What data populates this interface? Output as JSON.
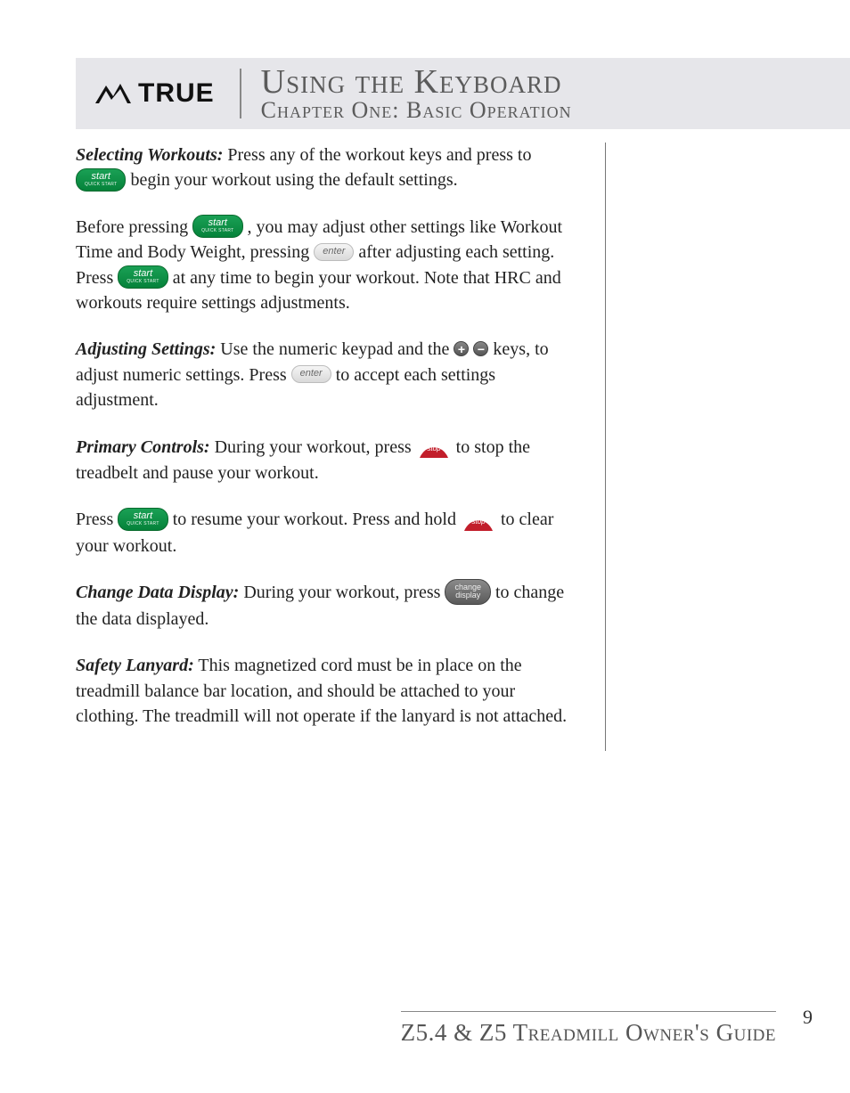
{
  "header": {
    "logo_text": "TRUE",
    "title": "Using the Keyboard",
    "subtitle": "Chapter One: Basic Operation"
  },
  "buttons": {
    "start": "start",
    "start_sub": "QUICK START",
    "enter": "enter",
    "stop": "stop",
    "change1": "change",
    "change2": "display"
  },
  "icons": {
    "plus": "+",
    "minus": "−"
  },
  "body": {
    "p1_lead": "Selecting Workouts:",
    "p1_a": " Press any of the workout keys and press to ",
    "p1_b": " begin your workout using the default settings.",
    "p2_a": "Before pressing ",
    "p2_b": " , you may adjust other settings like Workout Time and Body Weight, pressing ",
    "p2_c": " after adjusting each setting. Press ",
    "p2_d": " at any time to begin your workout. Note that HRC and workouts require settings adjustments.",
    "p3_lead": "Adjusting Settings:",
    "p3_a": " Use the numeric keypad and the ",
    "p3_b": " keys, to adjust numeric settings. Press ",
    "p3_c": " to accept each settings adjustment.",
    "p4_lead": "Primary Controls:",
    "p4_a": " During your workout, press ",
    "p4_b": " to stop the treadbelt and pause your workout.",
    "p5_a": "Press ",
    "p5_b": " to resume your workout. Press and hold ",
    "p5_c": " to clear your workout.",
    "p6_lead": "Change Data Display:",
    "p6_a": " During your workout, press ",
    "p6_b": " to change the data displayed.",
    "p7_lead": "Safety Lanyard:",
    "p7_a": " This magnetized cord must be in place on the treadmill balance bar location, and should be attached to your clothing. The treadmill will not operate if the lanyard is not attached."
  },
  "footer": {
    "guide": "Z5.4 & Z5 Treadmill Owner's Guide",
    "page": "9"
  }
}
